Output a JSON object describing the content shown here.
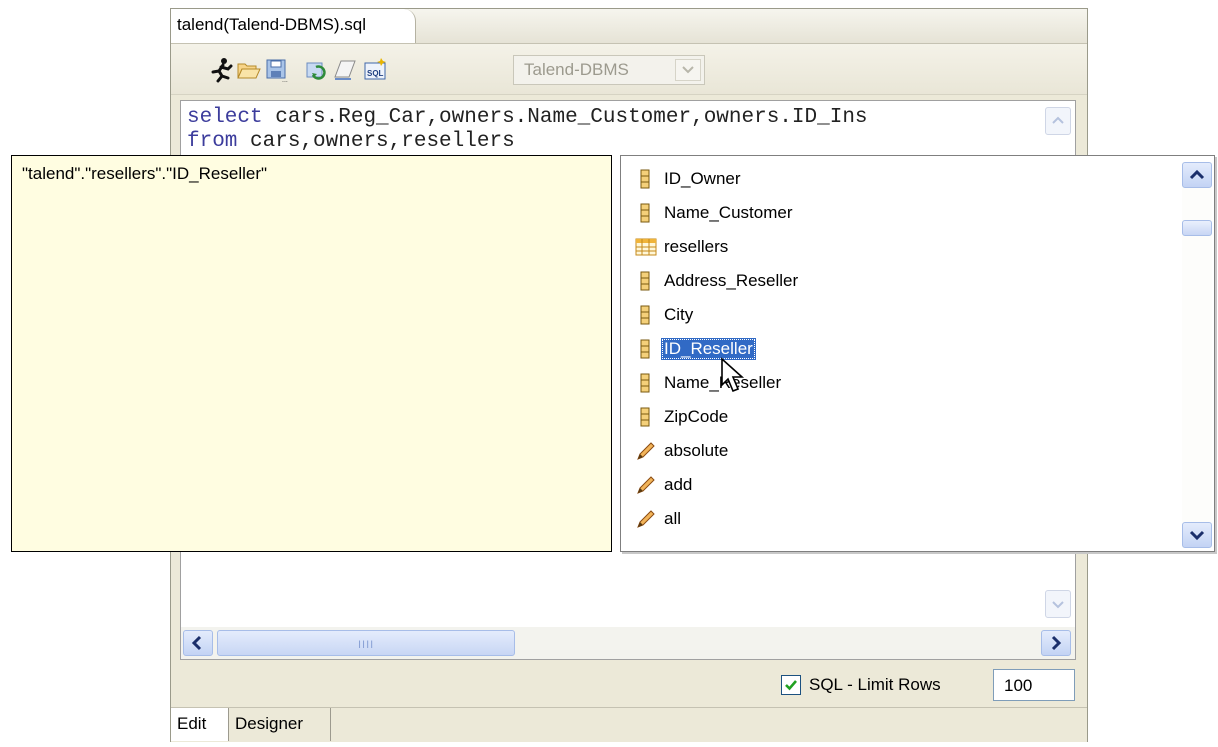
{
  "editor": {
    "tab_title": "talend(Talend-DBMS).sql",
    "toolbar": {
      "icons": [
        "run-icon",
        "open-folder-icon",
        "save-icon",
        "refresh-icon",
        "eraser-icon",
        "sql-builder-icon"
      ],
      "db_select_value": "Talend-DBMS"
    },
    "code_lines": [
      {
        "keyword": "select",
        "rest": " cars.Reg_Car,owners.Name_Customer,owners.ID_Ins"
      },
      {
        "keyword": "from",
        "rest": " cars,owners,resellers"
      }
    ],
    "scroll_grip": "IIII",
    "limit_rows": {
      "checked": true,
      "label": "SQL - Limit Rows",
      "value": "100"
    },
    "bottom_tabs": [
      "Edit",
      "Designer"
    ]
  },
  "tooltip": {
    "text": "\"talend\".\"resellers\".\"ID_Reseller\""
  },
  "completion": {
    "items": [
      {
        "label": "ID_Owner",
        "icon": "column-icon"
      },
      {
        "label": "Name_Customer",
        "icon": "column-icon"
      },
      {
        "label": "resellers",
        "icon": "table-icon"
      },
      {
        "label": "Address_Reseller",
        "icon": "column-icon"
      },
      {
        "label": "City",
        "icon": "column-icon"
      },
      {
        "label": "ID_Reseller",
        "icon": "column-icon",
        "selected": true
      },
      {
        "label": "Name_Reseller",
        "icon": "column-icon"
      },
      {
        "label": "ZipCode",
        "icon": "column-icon"
      },
      {
        "label": "absolute",
        "icon": "keyword-icon"
      },
      {
        "label": "add",
        "icon": "keyword-icon"
      },
      {
        "label": "all",
        "icon": "keyword-icon"
      }
    ]
  },
  "colors": {
    "selection": "#316ac5",
    "tooltip_bg": "#fffde1",
    "keyword": "#3c3c9c"
  }
}
